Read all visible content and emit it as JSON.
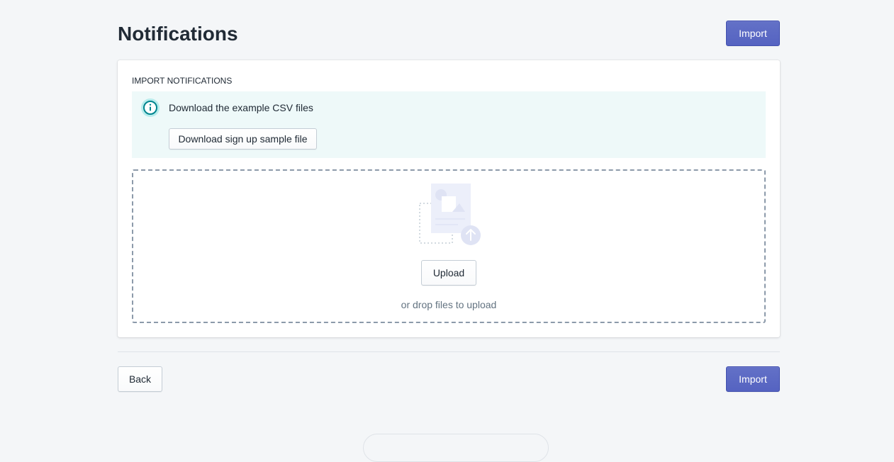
{
  "header": {
    "title": "Notifications",
    "import_label": "Import"
  },
  "card": {
    "section_title": "IMPORT NOTIFICATIONS",
    "banner": {
      "text": "Download the example CSV files",
      "download_label": "Download sign up sample file"
    },
    "dropzone": {
      "upload_label": "Upload",
      "hint": "or drop files to upload"
    }
  },
  "footer": {
    "back_label": "Back",
    "import_label": "Import"
  },
  "icons": {
    "info": "info-icon",
    "upload_illustration": "file-upload-illustration-icon",
    "upload_arrow": "arrow-up-icon"
  },
  "colors": {
    "primary": "#5c6ac4",
    "banner_bg": "#eef9f9",
    "info_accent": "#47c1bf",
    "page_bg": "#f4f6f8"
  }
}
